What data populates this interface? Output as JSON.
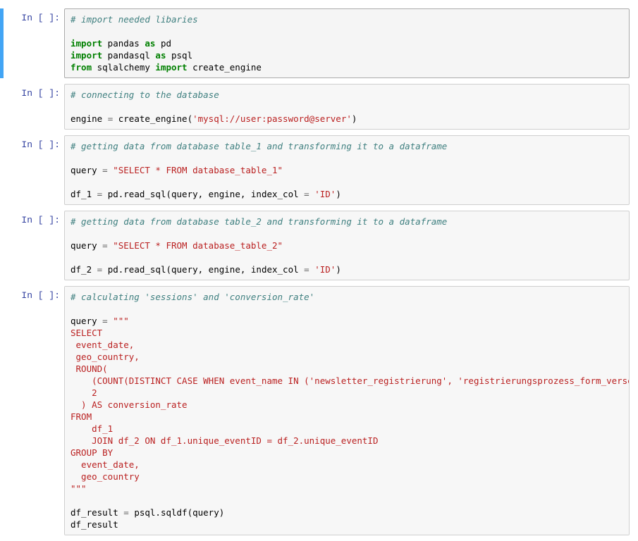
{
  "prompt_label": "In [ ]:",
  "cells": {
    "c0_t0": "# import needed libaries",
    "c0_t1": "import",
    "c0_t2": " pandas ",
    "c0_t3": "as",
    "c0_t4": " pd",
    "c0_t5": "import",
    "c0_t6": " pandasql ",
    "c0_t7": "as",
    "c0_t8": " psql",
    "c0_t9": "from",
    "c0_t10": " sqlalchemy ",
    "c0_t11": "import",
    "c0_t12": " create_engine",
    "c1_t0": "# connecting to the database",
    "c1_t1": "engine ",
    "c1_t2": "=",
    "c1_t3": " create_engine(",
    "c1_t4": "'mysql://user:password@server'",
    "c1_t5": ")",
    "c2_t0": "# getting data from database table_1 and transforming it to a dataframe",
    "c2_t1": "query ",
    "c2_t2": "=",
    "c2_t3": " ",
    "c2_t4": "\"SELECT * FROM database_table_1\"",
    "c2_t5": "df_1 ",
    "c2_t6": "=",
    "c2_t7": " pd.read_sql(query, engine, index_col ",
    "c2_t8": "=",
    "c2_t9": " ",
    "c2_t10": "'ID'",
    "c2_t11": ")",
    "c3_t0": "# getting data from database table_2 and transforming it to a dataframe",
    "c3_t1": "query ",
    "c3_t2": "=",
    "c3_t3": " ",
    "c3_t4": "\"SELECT * FROM database_table_2\"",
    "c3_t5": "df_2 ",
    "c3_t6": "=",
    "c3_t7": " pd.read_sql(query, engine, index_col ",
    "c3_t8": "=",
    "c3_t9": " ",
    "c3_t10": "'ID'",
    "c3_t11": ")",
    "c4_t0": "# calculating 'sessions' and 'conversion_rate'",
    "c4_t1": "query ",
    "c4_t2": "=",
    "c4_t3": " ",
    "c4_t4": "\"\"\"",
    "c4_t5": "SELECT",
    "c4_t6": " event_date,",
    "c4_t7": " geo_country,",
    "c4_t8": " ROUND(",
    "c4_t9": "    (COUNT(DISTINCT CASE WHEN event_name IN ('newsletter_registrierung', 'registrierungsprozess_form_versendet', 'purchase') THEN",
    "c4_t10": "    2",
    "c4_t11": "  ) AS conversion_rate",
    "c4_t12": "FROM",
    "c4_t13": "    df_1",
    "c4_t14": "    JOIN df_2 ON df_1.unique_eventID = df_2.unique_eventID",
    "c4_t15": "GROUP BY",
    "c4_t16": "  event_date,",
    "c4_t17": "  geo_country",
    "c4_t18": "\"\"\"",
    "c4_t19": "df_result ",
    "c4_t20": "=",
    "c4_t21": " psql.sqldf(query)",
    "c4_t22": "df_result"
  }
}
